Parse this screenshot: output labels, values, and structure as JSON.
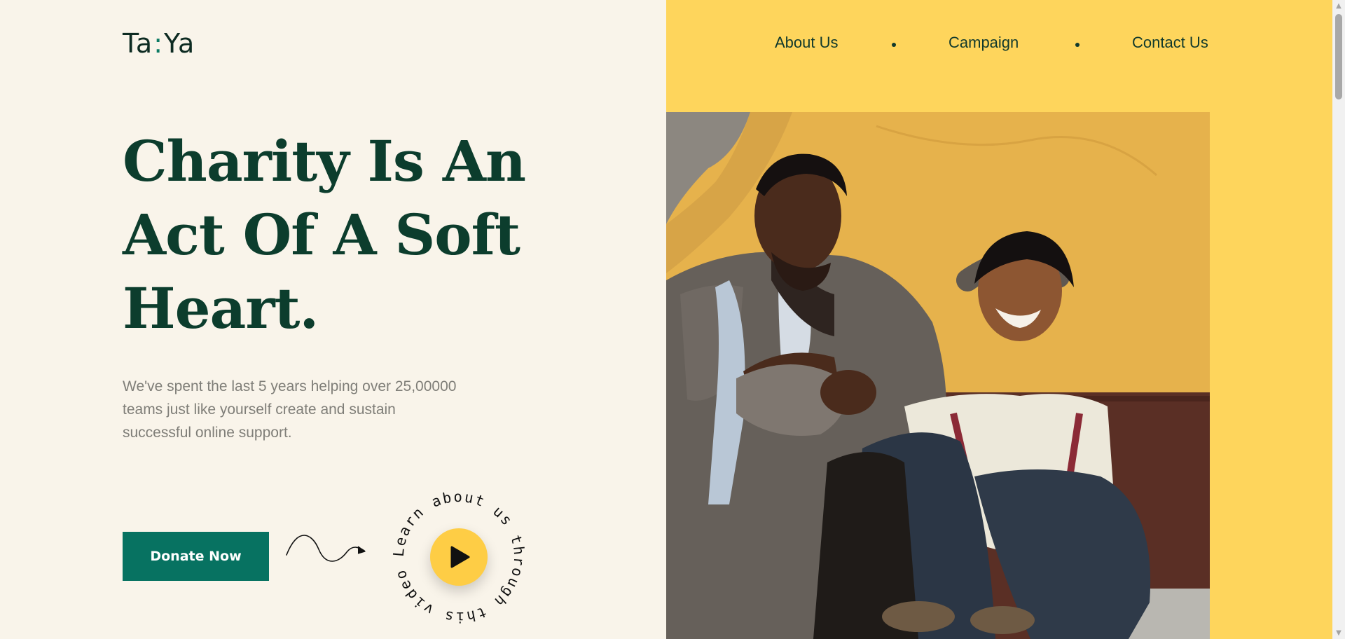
{
  "brand": {
    "left": "Ta",
    "colon": ":",
    "right": "Ya"
  },
  "nav": {
    "items": [
      "About Us",
      "Campaign",
      "Contact Us"
    ]
  },
  "hero": {
    "title_lines": [
      "Charity Is An",
      "Act Of A Soft",
      "Heart."
    ],
    "subtext_lines": [
      "We've spent the last 5 years helping over 25,00000",
      "teams just like yourself create and sustain",
      "successful online support."
    ],
    "donate_label": "Donate Now",
    "video_text": "Learn about us through this video"
  },
  "icons": {
    "play": "play-icon",
    "squiggle_arrow": "squiggle-arrow-icon",
    "scroll_up": "chevron-up-icon",
    "scroll_down": "chevron-down-icon"
  },
  "colors": {
    "background": "#f9f4ea",
    "panel_yellow": "#fed55c",
    "heading_green": "#0c3d2d",
    "button_green": "#077261",
    "play_yellow": "#fecd45",
    "logo_accent": "#0b7a63"
  }
}
